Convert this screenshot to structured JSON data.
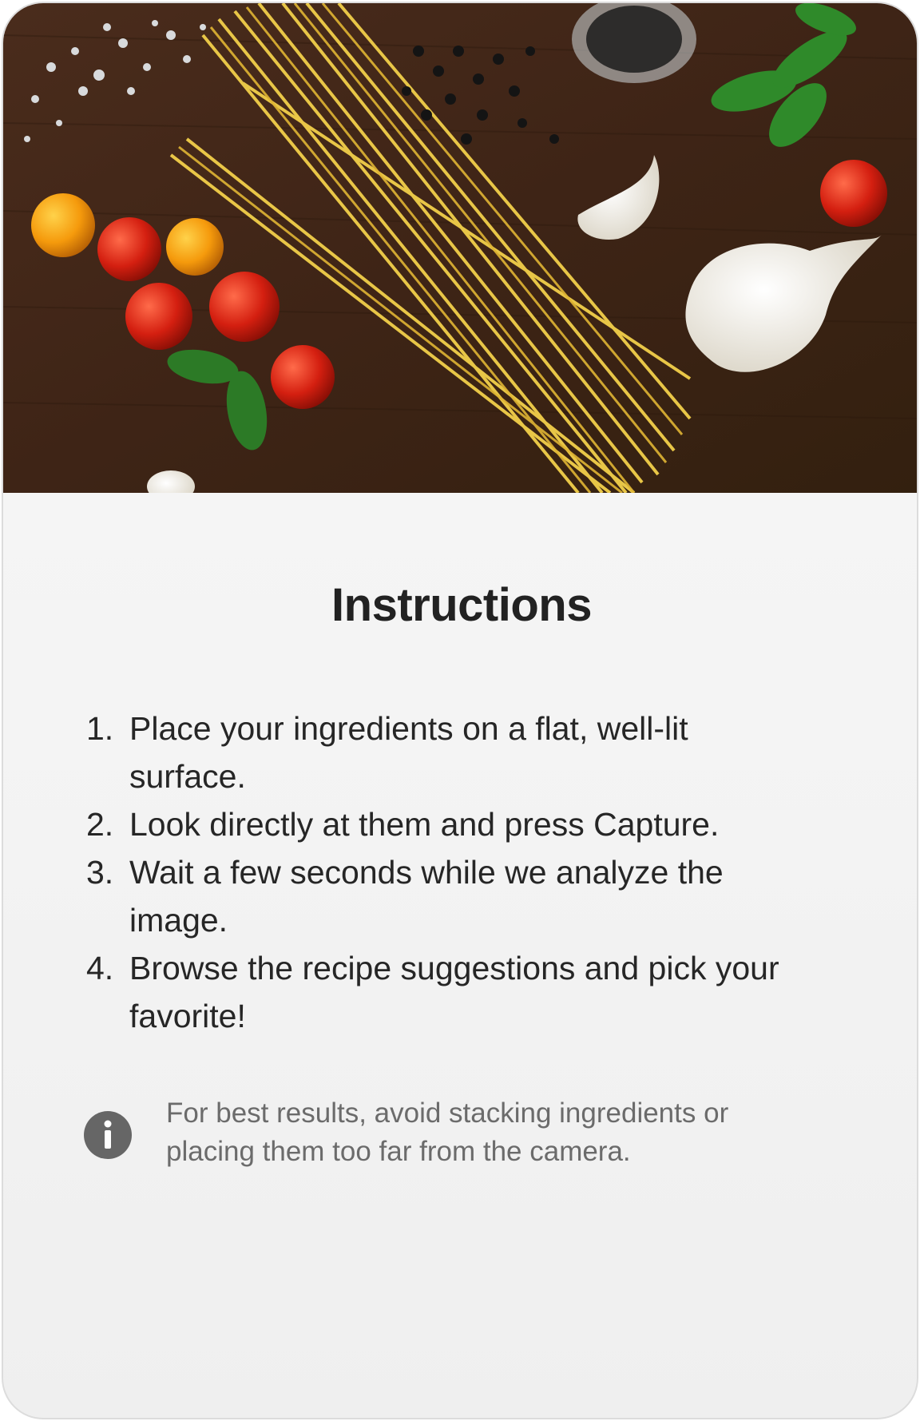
{
  "hero": {
    "image_description": "pasta-ingredients-photo"
  },
  "instructions": {
    "title": "Instructions",
    "steps": [
      {
        "number": "1.",
        "text": "Place your ingredients on a flat, well-lit surface."
      },
      {
        "number": "2.",
        "text": "Look directly at them and press Capture."
      },
      {
        "number": "3.",
        "text": "Wait a few seconds while we analyze the image."
      },
      {
        "number": "4.",
        "text": "Browse the recipe suggestions and pick your favorite!"
      }
    ],
    "tip": {
      "icon": "info-icon",
      "text": "For best results, avoid stacking ingredients or placing them too far from the camera."
    }
  },
  "colors": {
    "card_background": "#f5f5f5",
    "title": "#222222",
    "step_text": "#262626",
    "tip_text": "#6b6b6b",
    "info_icon": "#666666"
  }
}
